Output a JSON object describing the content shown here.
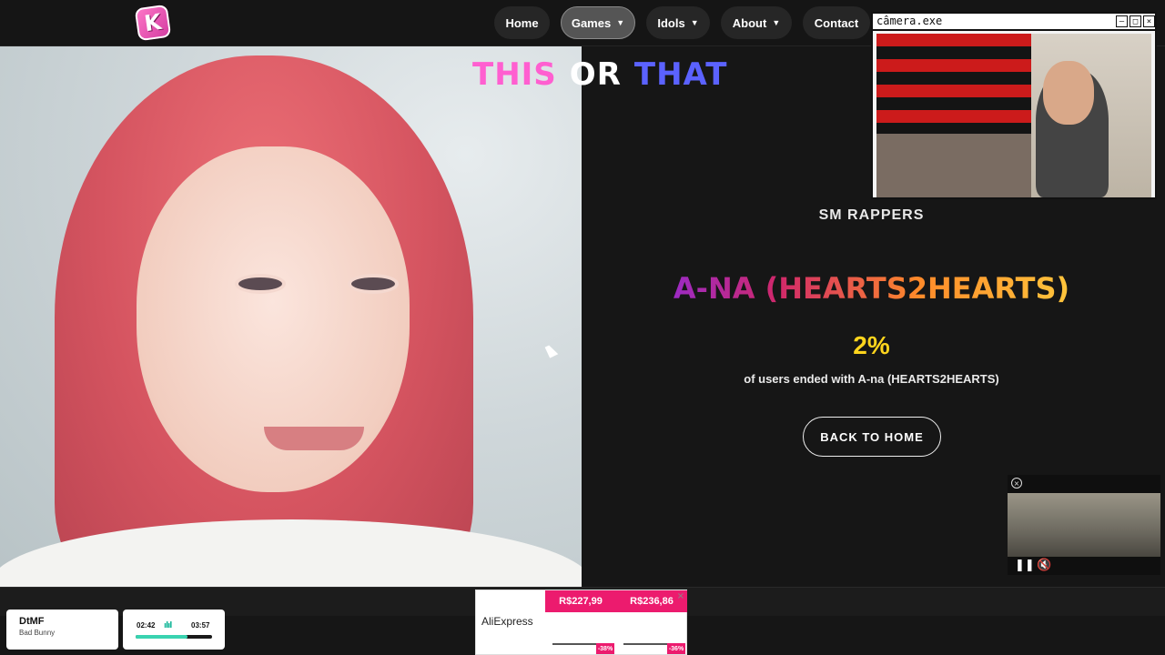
{
  "nav": {
    "logo_letter": "K",
    "items": [
      {
        "label": "Home",
        "dropdown": false,
        "active": false
      },
      {
        "label": "Games",
        "dropdown": true,
        "active": true
      },
      {
        "label": "Idols",
        "dropdown": true,
        "active": false
      },
      {
        "label": "About",
        "dropdown": true,
        "active": false
      },
      {
        "label": "Contact",
        "dropdown": false,
        "active": false
      }
    ]
  },
  "game_title": {
    "word1": "THIS",
    "word2": "OR",
    "word3": "THAT"
  },
  "result": {
    "category": "SM RAPPERS",
    "idol_name": "A-NA (HEARTS2HEARTS)",
    "percent": "2%",
    "description": "of users ended with A-na (HEARTS2HEARTS)",
    "back_button": "BACK TO HOME"
  },
  "camera_window": {
    "title": "câmera.exe"
  },
  "music": {
    "song": "DtMF",
    "artist": "Bad Bunny",
    "elapsed": "02:42",
    "total": "03:57",
    "progress": 0.68
  },
  "ad": {
    "brand": "AliExpress",
    "price1": "R$227,99",
    "price2": "R$236,86",
    "discount1": "-38%",
    "discount2": "-36%"
  },
  "colors": {
    "accent_pink": "#ff5fd0",
    "accent_blue": "#5b62ff",
    "percent_yellow": "#ffd51d",
    "music_teal": "#39d3b0"
  }
}
